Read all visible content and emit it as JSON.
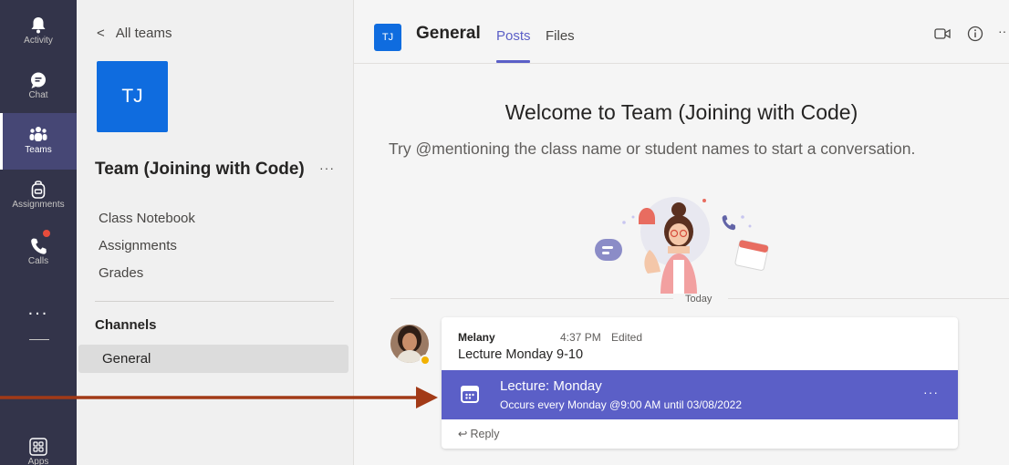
{
  "rail": {
    "items": [
      {
        "label": "Activity",
        "icon": "bell-icon"
      },
      {
        "label": "Chat",
        "icon": "chat-icon"
      },
      {
        "label": "Teams",
        "icon": "teams-icon"
      },
      {
        "label": "Assignments",
        "icon": "backpack-icon"
      },
      {
        "label": "Calls",
        "icon": "phone-icon"
      }
    ],
    "more": "...",
    "apps_label": "Apps",
    "active": "Teams"
  },
  "team_panel": {
    "back_label": "All teams",
    "avatar_initials": "TJ",
    "team_name": "Team (Joining with Code)",
    "more": "···",
    "links": [
      "Class Notebook",
      "Assignments",
      "Grades"
    ],
    "channels_heading": "Channels",
    "channels": [
      "General"
    ]
  },
  "header": {
    "channel_initials": "TJ",
    "channel_name": "General",
    "tabs": [
      "Posts",
      "Files"
    ],
    "active_tab": "Posts",
    "more": "··"
  },
  "welcome": {
    "title": "Welcome to Team (Joining with Code)",
    "subtitle": "Try @mentioning the class name or student names to start a conversation."
  },
  "feed": {
    "date_divider": "Today",
    "post": {
      "author": "Melany",
      "time": "4:37 PM",
      "edited": "Edited",
      "message": "Lecture Monday 9-10",
      "meeting": {
        "title": "Lecture: Monday",
        "detail": "Occurs every Monday @9:00 AM until 03/08/2022",
        "more": "···"
      },
      "reply_label": "Reply"
    }
  },
  "colors": {
    "rail": "#33344a",
    "accent": "#5b5fc7",
    "team_blue": "#0f6cdf",
    "annotation_arrow": "#a23a17"
  }
}
